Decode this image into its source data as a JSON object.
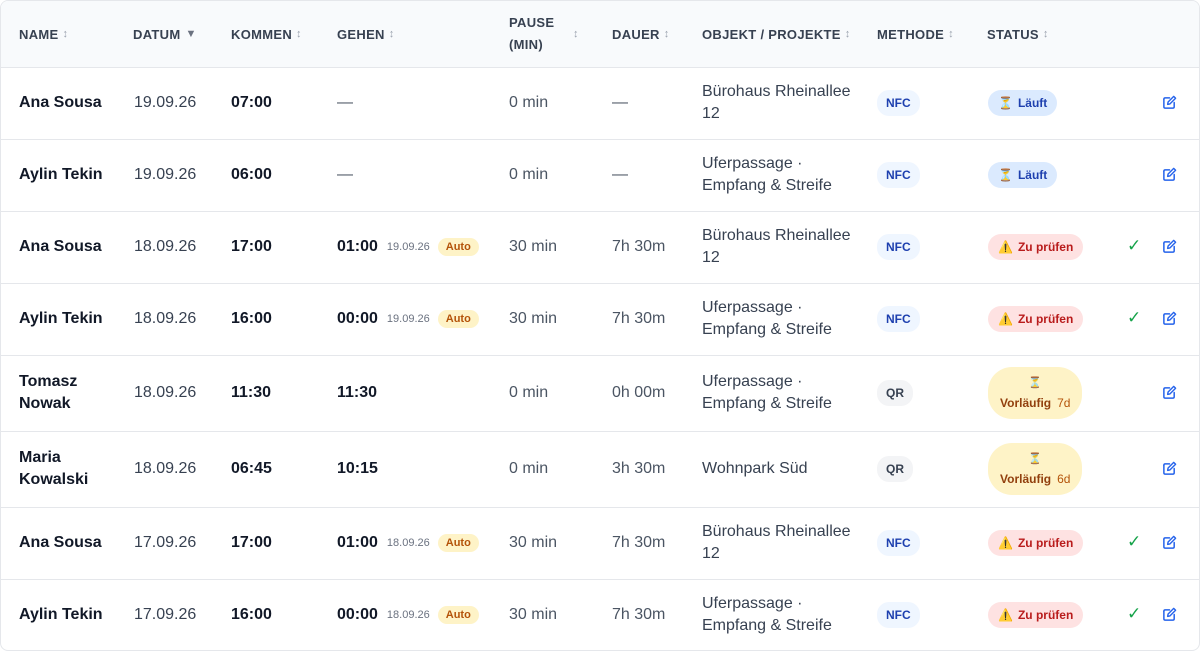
{
  "headers": {
    "name": "NAME",
    "datum": "DATUM",
    "kommen": "KOMMEN",
    "gehen": "GEHEN",
    "pause_line1": "PAUSE",
    "pause_line2": "(MIN)",
    "dauer": "DAUER",
    "objekt": "OBJEKT / PROJEKTE",
    "methode": "METHODE",
    "status": "STATUS"
  },
  "rows": [
    {
      "name1": "Ana Sousa",
      "name2": "",
      "datum": "19.09.26",
      "kommen": "07:00",
      "gehen": "—",
      "gehen_date": "",
      "auto": "",
      "pause": "0 min",
      "dauer": "—",
      "objekt1": "Bürohaus Rheinallee",
      "objekt2": "12",
      "methode": "NFC",
      "status": "Läuft",
      "status_type": "running",
      "status_days": "",
      "approved": false
    },
    {
      "name1": "Aylin Tekin",
      "name2": "",
      "datum": "19.09.26",
      "kommen": "06:00",
      "gehen": "—",
      "gehen_date": "",
      "auto": "",
      "pause": "0 min",
      "dauer": "—",
      "objekt1": "Uferpassage ·",
      "objekt2": "Empfang & Streife",
      "methode": "NFC",
      "status": "Läuft",
      "status_type": "running",
      "status_days": "",
      "approved": false
    },
    {
      "name1": "Ana Sousa",
      "name2": "",
      "datum": "18.09.26",
      "kommen": "17:00",
      "gehen": "01:00",
      "gehen_date": "19.09.26",
      "auto": "Auto",
      "pause": "30 min",
      "dauer": "7h 30m",
      "objekt1": "Bürohaus Rheinallee",
      "objekt2": "12",
      "methode": "NFC",
      "status": "Zu prüfen",
      "status_type": "check",
      "status_days": "",
      "approved": true
    },
    {
      "name1": "Aylin Tekin",
      "name2": "",
      "datum": "18.09.26",
      "kommen": "16:00",
      "gehen": "00:00",
      "gehen_date": "19.09.26",
      "auto": "Auto",
      "pause": "30 min",
      "dauer": "7h 30m",
      "objekt1": "Uferpassage ·",
      "objekt2": "Empfang & Streife",
      "methode": "NFC",
      "status": "Zu prüfen",
      "status_type": "check",
      "status_days": "",
      "approved": true
    },
    {
      "name1": "Tomasz",
      "name2": "Nowak",
      "datum": "18.09.26",
      "kommen": "11:30",
      "gehen": "11:30",
      "gehen_date": "",
      "auto": "",
      "pause": "0 min",
      "dauer": "0h 00m",
      "objekt1": "Uferpassage ·",
      "objekt2": "Empfang & Streife",
      "methode": "QR",
      "status": "Vorläufig",
      "status_type": "prelim",
      "status_days": "7d",
      "approved": false
    },
    {
      "name1": "Maria",
      "name2": "Kowalski",
      "datum": "18.09.26",
      "kommen": "06:45",
      "gehen": "10:15",
      "gehen_date": "",
      "auto": "",
      "pause": "0 min",
      "dauer": "3h 30m",
      "objekt1": "Wohnpark Süd",
      "objekt2": "",
      "methode": "QR",
      "status": "Vorläufig",
      "status_type": "prelim",
      "status_days": "6d",
      "approved": false
    },
    {
      "name1": "Ana Sousa",
      "name2": "",
      "datum": "17.09.26",
      "kommen": "17:00",
      "gehen": "01:00",
      "gehen_date": "18.09.26",
      "auto": "Auto",
      "pause": "30 min",
      "dauer": "7h 30m",
      "objekt1": "Bürohaus Rheinallee",
      "objekt2": "12",
      "methode": "NFC",
      "status": "Zu prüfen",
      "status_type": "check",
      "status_days": "",
      "approved": true
    },
    {
      "name1": "Aylin Tekin",
      "name2": "",
      "datum": "17.09.26",
      "kommen": "16:00",
      "gehen": "00:00",
      "gehen_date": "18.09.26",
      "auto": "Auto",
      "pause": "30 min",
      "dauer": "7h 30m",
      "objekt1": "Uferpassage ·",
      "objekt2": "Empfang & Streife",
      "methode": "NFC",
      "status": "Zu prüfen",
      "status_type": "check",
      "status_days": "",
      "approved": true
    }
  ],
  "icons": {
    "sort": "sort-arrows-icon",
    "sort_active": "sort-down-icon",
    "running": "hourglass-icon",
    "check": "warning-icon",
    "prelim": "hourglass-icon",
    "approve": "checkmark-icon",
    "edit": "edit-icon"
  },
  "colors": {
    "accent": "#2563eb",
    "approve": "#16a34a",
    "running_bg": "#dbeafe",
    "check_bg": "#fee2e2",
    "prelim_bg": "#fef3c7"
  }
}
